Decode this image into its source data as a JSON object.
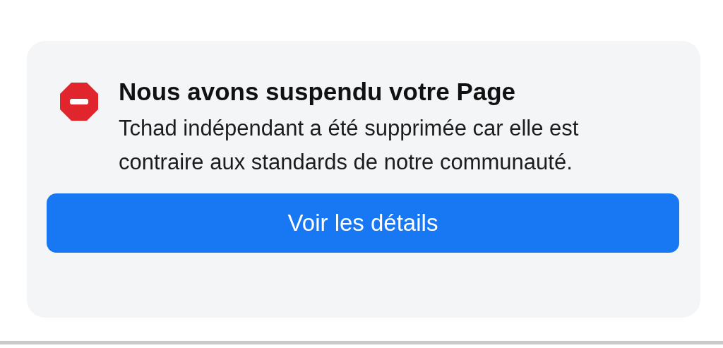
{
  "notice": {
    "title": "Nous avons suspendu votre Page",
    "message": "Tchad indépendant a été supprimée car elle est contraire aux standards de notre communauté.",
    "button": "Voir les détails"
  }
}
